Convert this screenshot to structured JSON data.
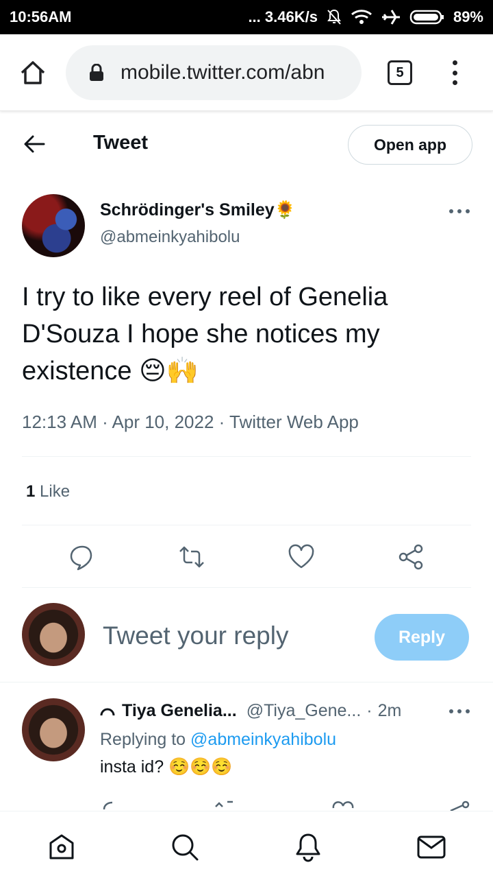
{
  "status_bar": {
    "time": "10:56AM",
    "network_speed": "... 3.46K/s",
    "battery": "89%",
    "icons": [
      "mute-icon",
      "wifi-icon",
      "airplane-mode-icon",
      "battery-icon"
    ]
  },
  "browser": {
    "url": "mobile.twitter.com/abn",
    "tab_count": "5"
  },
  "header": {
    "title": "Tweet",
    "open_app_label": "Open app"
  },
  "tweet": {
    "author_name": "Schrödinger's Smiley🌻",
    "author_handle": "@abmeinkyahibolu",
    "text": "I try to like every reel of Genelia D'Souza I hope she notices my existence 😔🙌",
    "meta": "12:13 AM · Apr 10, 2022 · Twitter Web App",
    "like_count": "1",
    "like_label": " Like"
  },
  "composer": {
    "placeholder": "Tweet your reply",
    "reply_label": "Reply"
  },
  "reply": {
    "name": "Tiya Genelia...",
    "handle": "@Tiya_Gene...",
    "separator": "·",
    "time": "2m",
    "replying_prefix": "Replying to ",
    "replying_mention": "@abmeinkyahibolu",
    "text": "insta id? ☺️☺️☺️"
  },
  "colors": {
    "accent": "#1d9bf0",
    "reply_button": "#8ecdf8",
    "secondary_text": "#536471"
  }
}
